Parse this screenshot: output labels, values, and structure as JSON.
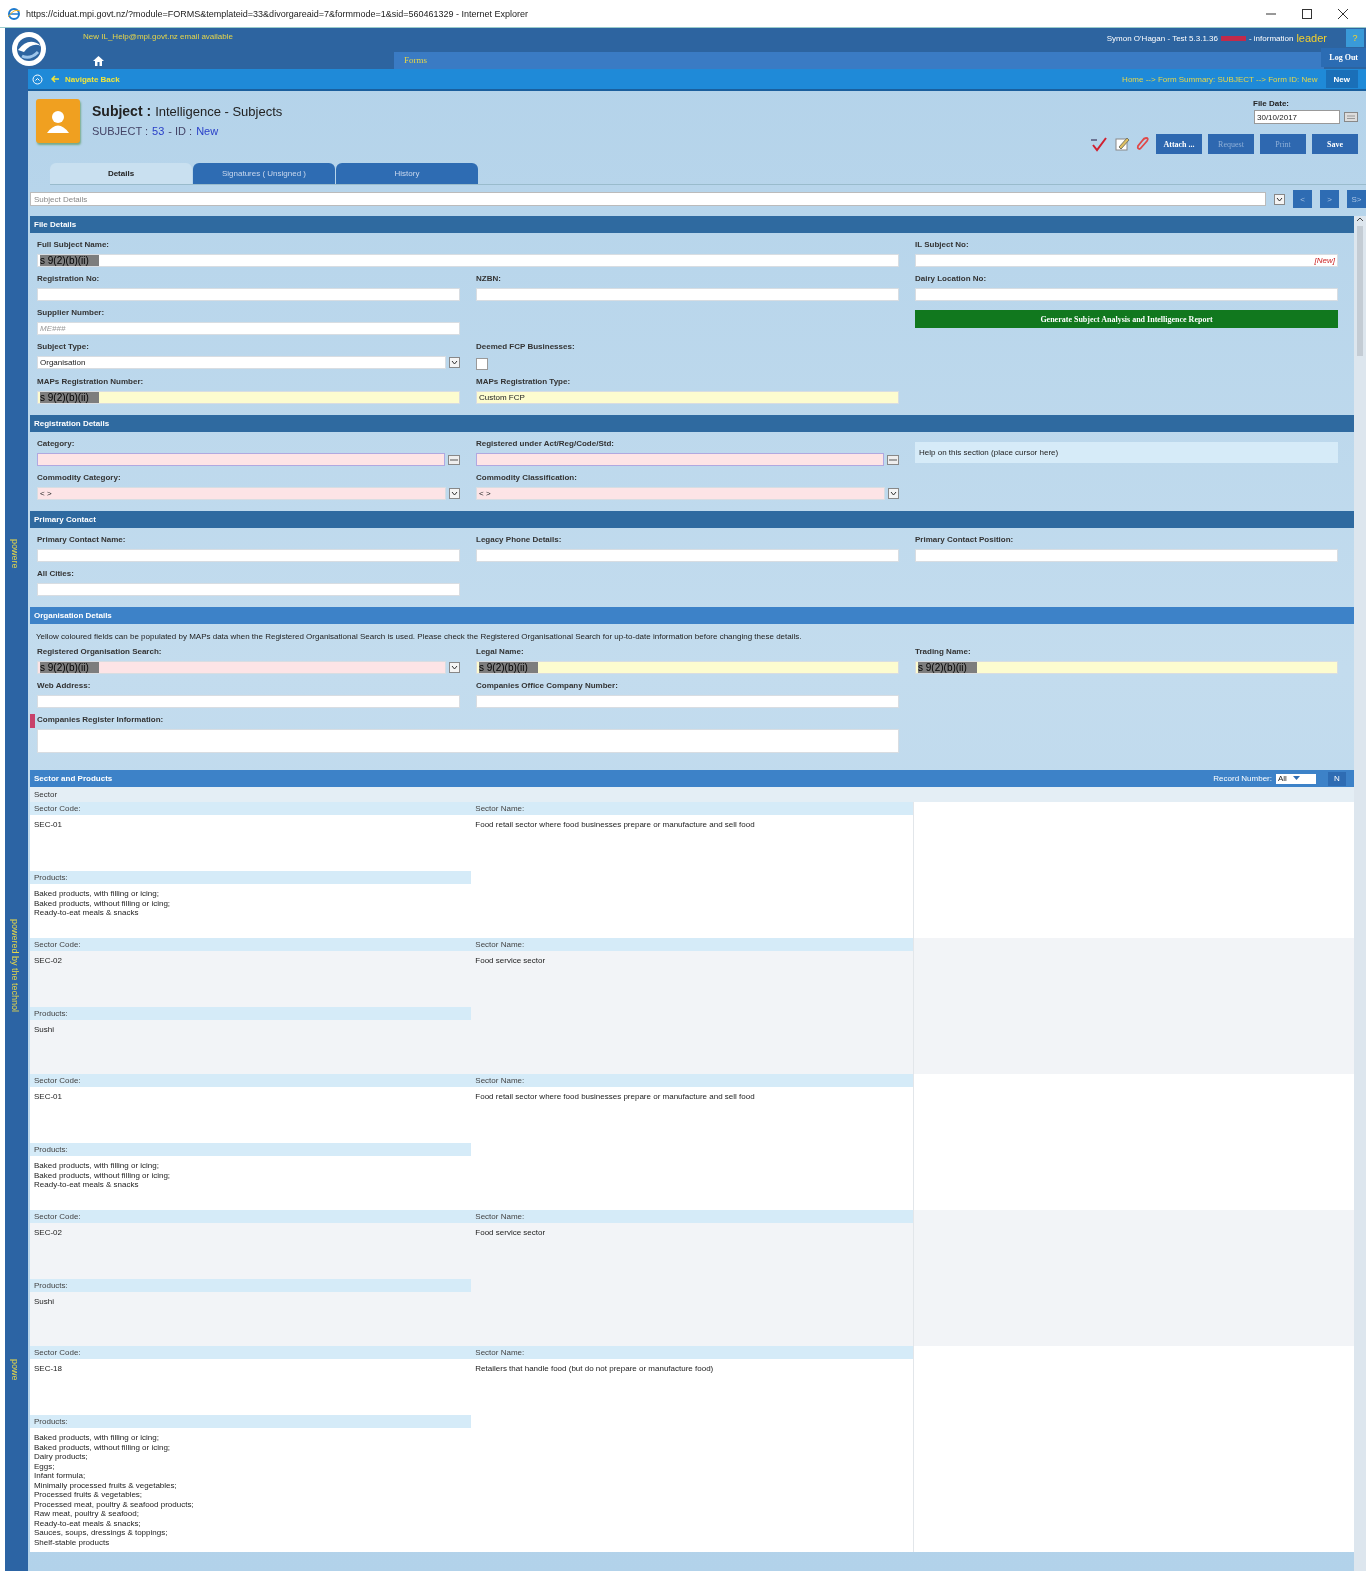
{
  "browser": {
    "title": "https://ciduat.mpi.govt.nz/?module=FORMS&templateid=33&divorgareaid=7&formmode=1&sid=560461329 - Internet Explorer"
  },
  "header": {
    "notice": "New IL_Help@mpi.govt.nz email available",
    "menu": [
      {
        "label": "Forms"
      }
    ],
    "user": "Symon O'Hagan - Test 5.3.1.36",
    "brand_prefix": "- information",
    "brand": "leader",
    "help": "?",
    "logout": "Log Out"
  },
  "side_strip": [
    "powere",
    "powered by the technol",
    "powe"
  ],
  "nav": {
    "back": "Navigate Back",
    "breadcrumb": "Home --> Form Summary: SUBJECT --> Form ID: New",
    "new": "New"
  },
  "subject": {
    "title": "Subject :",
    "subtitle": "Intelligence - Subjects",
    "id_label": "SUBJECT :",
    "id_number": "53",
    "id_sep": "- ID :",
    "id_value": "New",
    "file_date_label": "File Date:",
    "file_date": "30/10/2017",
    "buttons": [
      {
        "label": "Attach ...",
        "disabled": false
      },
      {
        "label": "Request",
        "disabled": true
      },
      {
        "label": "Print",
        "disabled": true
      },
      {
        "label": "Save",
        "disabled": false
      }
    ]
  },
  "tabs": [
    {
      "label": "Details",
      "selected": true
    },
    {
      "label": "Signatures ( Unsigned )",
      "selected": false
    },
    {
      "label": "History",
      "selected": false
    }
  ],
  "section_select": {
    "value": "Subject Details",
    "buttons": [
      "<",
      ">",
      "S>"
    ]
  },
  "sections": [
    {
      "title": "File Details",
      "rows": [
        [
          {
            "kind": "wide_text",
            "label": "Full Subject Name:",
            "value": "s 9(2)(b)(ii)",
            "redacted": true
          },
          "",
          {
            "kind": "text",
            "label": "IL Subject No:",
            "marker": "[New]"
          }
        ],
        [
          {
            "kind": "text",
            "label": "Registration No:"
          },
          {
            "kind": "text",
            "label": "NZBN:"
          },
          {
            "kind": "text",
            "label": "Dairy Location No:"
          }
        ],
        [
          {
            "kind": "text",
            "label": "Supplier Number:",
            "placeholder": "ME###"
          },
          "",
          {
            "kind": "button",
            "label": "Generate Subject Analysis and Intelligence Report"
          }
        ],
        [
          {
            "kind": "select",
            "label": "Subject Type:",
            "value": "Organisation"
          },
          {
            "kind": "checkbox",
            "label": "Deemed FCP Businesses:",
            "checked": false
          }
        ],
        [
          {
            "kind": "text",
            "label": "MAPs Registration Number:",
            "color": "#fdfccf",
            "value": "s 9(2)(b)(ii)",
            "redacted": true
          },
          {
            "kind": "text",
            "label": "MAPs Registration Type:",
            "color": "#fdfccf",
            "value": "Custom FCP",
            "redacted": false
          }
        ]
      ]
    },
    {
      "title": "Registration Details",
      "rows": [
        [
          {
            "kind": "lookup",
            "label": "Category:",
            "color": "#fde4e6"
          },
          {
            "kind": "lookup",
            "label": "Registered under Act/Reg/Code/Std:",
            "color": "#fde4e6"
          },
          {
            "kind": "help",
            "value": "Help on this section (place cursor here)"
          }
        ],
        [
          {
            "kind": "select",
            "label": "Commodity Category:",
            "color": "#fde4e6",
            "value": "< >"
          },
          {
            "kind": "select",
            "label": "Commodity Classification:",
            "color": "#fde4e6",
            "value": "< >"
          }
        ]
      ]
    },
    {
      "title": "Primary Contact",
      "rows": [
        [
          {
            "kind": "text",
            "label": "Primary Contact Name:"
          },
          {
            "kind": "text",
            "label": "Legacy Phone Details:"
          },
          {
            "kind": "text",
            "label": "Primary Contact Position:"
          }
        ],
        [
          {
            "kind": "text",
            "label": "All Cities:"
          }
        ]
      ]
    },
    {
      "title": "Organisation Details",
      "note": "Yellow coloured fields can be populated by MAPs data when the Registered Organisational Search is used.  Please check the Registered Organisational Search for up-to-date information before changing these details.",
      "rows": [
        [
          {
            "kind": "select",
            "label": "Registered Organisation Search:",
            "color": "#fde4e6",
            "value": "s 9(2)(b)(ii)",
            "redacted": true
          },
          {
            "kind": "text",
            "label": "Legal Name:",
            "color": "#fdfccf",
            "value": "s 9(2)(b)(ii)",
            "redacted": true
          },
          {
            "kind": "text",
            "label": "Trading Name:",
            "color": "#fdfccf",
            "value": "s 9(2)(b)(ii)",
            "redacted": true
          }
        ],
        [
          {
            "kind": "text",
            "label": "Web Address:"
          },
          {
            "kind": "text",
            "label": "Companies Office Company Number:"
          }
        ],
        [
          {
            "kind": "wide_area",
            "label": "Companies Register Information:",
            "required": true
          },
          ""
        ]
      ]
    }
  ],
  "sectors": {
    "title": "Sector and Products",
    "record_label": "Record Number:",
    "record_value": "All",
    "record_button": "N",
    "subtitle": "Sector",
    "records": [
      {
        "code_label": "Sector Code:",
        "code": "SEC-01",
        "name_label": "Sector Name:",
        "name": "Food retail sector where food businesses prepare or manufacture and sell food",
        "products_label": "Products:",
        "products": [
          "Baked products, with filling or icing;",
          "Baked products, without filling or icing;",
          "Ready-to-eat meals & snacks"
        ]
      },
      {
        "code_label": "Sector Code:",
        "code": "SEC-02",
        "name_label": "Sector Name:",
        "name": "Food service sector",
        "products_label": "Products:",
        "products": [
          "Sushi"
        ]
      },
      {
        "code_label": "Sector Code:",
        "code": "SEC-01",
        "name_label": "Sector Name:",
        "name": "Food retail sector where food businesses prepare or manufacture and sell food",
        "products_label": "Products:",
        "products": [
          "Baked products, with filling or icing;",
          "Baked products, without filling or icing;",
          "Ready-to-eat meals & snacks"
        ]
      },
      {
        "code_label": "Sector Code:",
        "code": "SEC-02",
        "name_label": "Sector Name:",
        "name": "Food service sector",
        "products_label": "Products:",
        "products": [
          "Sushi"
        ]
      },
      {
        "code_label": "Sector Code:",
        "code": "SEC-18",
        "name_label": "Sector Name:",
        "name": "Retailers that handle food (but do not prepare or manufacture food)",
        "products_label": "Products:",
        "products": [
          "Baked products, with filling or icing;",
          "Baked products, without filling or icing;",
          "Dairy products;",
          "Eggs;",
          "Infant formula;",
          "Minimally processed fruits & vegetables;",
          "Processed fruits & vegetables;",
          "Processed meat, poultry & seafood products;",
          "Raw meat, poultry & seafood;",
          "Ready-to-eat meals & snacks;",
          "Sauces, soups, dressings & toppings;",
          "Shelf-stable products"
        ]
      }
    ]
  }
}
